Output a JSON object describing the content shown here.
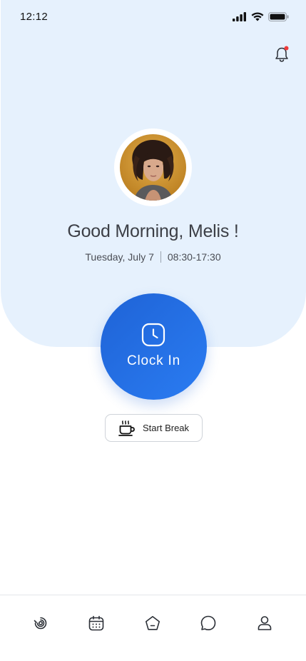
{
  "status_bar": {
    "time": "12:12",
    "icons": [
      "signal-icon",
      "wifi-icon",
      "battery-icon"
    ]
  },
  "header": {
    "notification_icon": "bell-icon",
    "has_unread": true
  },
  "profile": {
    "greeting": "Good Morning, Melis !",
    "date": "Tuesday, July 7",
    "shift": "08:30-17:30"
  },
  "actions": {
    "clock_in_label": "Clock In",
    "start_break_label": "Start Break"
  },
  "bottom_nav": {
    "items": [
      "dashboard-icon",
      "calendar-icon",
      "home-icon",
      "chat-icon",
      "profile-icon"
    ]
  },
  "colors": {
    "hero_background": "#e6f1fd",
    "primary_blue": "#2a7cf2",
    "notification_dot": "#ef3b3b"
  }
}
